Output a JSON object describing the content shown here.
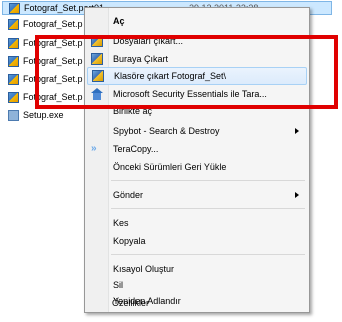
{
  "files": [
    {
      "name": "Fotograf_Set.part01",
      "date": "29.12.2011 22:38",
      "icon": "archive-icon",
      "selected": true
    },
    {
      "name": "Fotograf_Set.p",
      "icon": "archive-icon"
    },
    {
      "name": "Fotograf_Set.p",
      "icon": "archive-icon"
    },
    {
      "name": "Fotograf_Set.p",
      "icon": "archive-icon"
    },
    {
      "name": "Fotograf_Set.p",
      "icon": "archive-icon"
    },
    {
      "name": "Fotograf_Set.p",
      "icon": "archive-icon"
    },
    {
      "name": "Setup.exe",
      "icon": "setup-icon"
    }
  ],
  "menu": {
    "open": "Aç",
    "extract_files": "Dosyaları çıkart...",
    "extract_here": "Buraya Çıkart",
    "extract_to_folder": "Klasöre çıkart Fotograf_Set\\",
    "mse_scan": "Microsoft Security Essentials ile Tara...",
    "combine": "Birlikte aç",
    "spybot": "Spybot - Search & Destroy",
    "teracopy": "TeraCopy...",
    "restore_previous": "Önceki Sürümleri Geri Yükle",
    "send_to": "Gönder",
    "cut": "Kes",
    "copy": "Kopyala",
    "create_shortcut": "Kısayol Oluştur",
    "delete": "Sil",
    "rename": "Yeniden Adlandır",
    "properties": "Özellikler"
  },
  "icons": {
    "winrar": "winrar-archive-icon",
    "mse": "microsoft-security-essentials-icon",
    "teracopy": "teracopy-icon",
    "submenu": "chevron-right-icon"
  },
  "colors": {
    "annotation": "#e00000",
    "selection": "#cce8ff",
    "highlight": "#dcebfc"
  }
}
